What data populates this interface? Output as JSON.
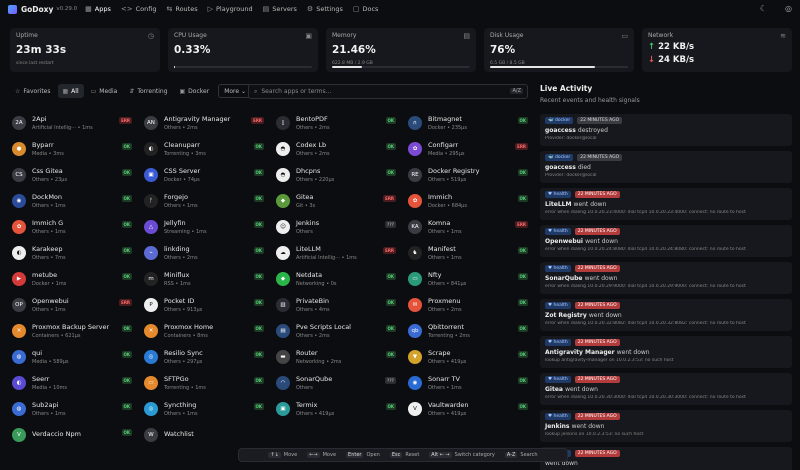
{
  "app": {
    "name": "GoDoxy",
    "version": "v0.29.0"
  },
  "nav": [
    {
      "label": "Apps",
      "icon": "grid-icon",
      "glyph": "▦",
      "active": true
    },
    {
      "label": "Config",
      "icon": "code-icon",
      "glyph": "<>"
    },
    {
      "label": "Routes",
      "icon": "routes-icon",
      "glyph": "⇆"
    },
    {
      "label": "Playground",
      "icon": "playground-icon",
      "glyph": "▷"
    },
    {
      "label": "Servers",
      "icon": "server-icon",
      "glyph": "▤"
    },
    {
      "label": "Settings",
      "icon": "gear-icon",
      "glyph": "⚙"
    },
    {
      "label": "Docs",
      "icon": "book-icon",
      "glyph": "▢"
    }
  ],
  "stats": {
    "uptime": {
      "label": "Uptime",
      "value": "23m 33s",
      "sub": "since last restart"
    },
    "cpu": {
      "label": "CPU Usage",
      "value": "0.33%",
      "fraction": 0.0033
    },
    "memory": {
      "label": "Memory",
      "value": "21.46%",
      "sub": "622.8 MB / 2.9 GB",
      "fraction": 0.2146
    },
    "disk": {
      "label": "Disk Usage",
      "value": "76%",
      "sub": "6.5 GB / 8.5 GB",
      "fraction": 0.76
    },
    "network": {
      "label": "Network",
      "up": "22 KB/s",
      "down": "24 KB/s"
    }
  },
  "filters": {
    "items": [
      {
        "label": "Favorites",
        "glyph": "☆",
        "icon": "star-icon"
      },
      {
        "label": "All",
        "glyph": "▦",
        "icon": "grid-icon",
        "active": true
      },
      {
        "label": "Media",
        "glyph": "▭",
        "icon": "media-icon"
      },
      {
        "label": "Torrenting",
        "glyph": "⇵",
        "icon": "torrent-icon"
      },
      {
        "label": "Docker",
        "glyph": "▣",
        "icon": "docker-icon"
      }
    ],
    "more": "More",
    "search_placeholder": "Search apps or terms...",
    "search_kbd": "A/Z"
  },
  "apps": [
    {
      "name": "2Api",
      "meta": "Artificial Intellig··· • 1ms",
      "status": "ERR",
      "s": "err",
      "color": "#3a3c44",
      "glyph": "2A"
    },
    {
      "name": "Antigravity Manager",
      "meta": "Others • 2ms",
      "status": "ERR",
      "s": "err",
      "color": "#3a3c44",
      "glyph": "AN"
    },
    {
      "name": "BentoPDF",
      "meta": "Others • 2ms",
      "status": "OK",
      "s": "ok",
      "color": "#2a2c33",
      "glyph": "▯"
    },
    {
      "name": "Bitmagnet",
      "meta": "Docker • 235μs",
      "status": "OK",
      "s": "ok",
      "color": "#2a4a7a",
      "glyph": "∩"
    },
    {
      "name": "Byparr",
      "meta": "Media • 3ms",
      "status": "OK",
      "s": "ok",
      "color": "#d88a2c",
      "glyph": "●"
    },
    {
      "name": "Cleanuparr",
      "meta": "Torrenting • 3ms",
      "status": "OK",
      "s": "ok",
      "color": "#222",
      "glyph": "◐"
    },
    {
      "name": "Codex Lb",
      "meta": "Others • 2ms",
      "status": "OK",
      "s": "ok",
      "color": "#eee",
      "glyph": "◓"
    },
    {
      "name": "Configarr",
      "meta": "Media • 295μs",
      "status": "ERR",
      "s": "err",
      "color": "#7b4bd3",
      "glyph": "✿"
    },
    {
      "name": "Css Gitea",
      "meta": "Others • 23μs",
      "status": "OK",
      "s": "ok",
      "color": "#3a3c44",
      "glyph": "CS"
    },
    {
      "name": "CSS Server",
      "meta": "Docker • 74μs",
      "status": "OK",
      "s": "ok",
      "color": "#3a5bd3",
      "glyph": "▣"
    },
    {
      "name": "Dhcpns",
      "meta": "Others • 220μs",
      "status": "OK",
      "s": "ok",
      "color": "#eee",
      "glyph": "◓"
    },
    {
      "name": "Docker Registry",
      "meta": "Others • 519μs",
      "status": "OK",
      "s": "ok",
      "color": "#3a3c44",
      "glyph": "RE"
    },
    {
      "name": "DockMon",
      "meta": "Others • 1ms",
      "status": "OK",
      "s": "ok",
      "color": "#2a4a9a",
      "glyph": "◉"
    },
    {
      "name": "Forgejo",
      "meta": "Others • 1ms",
      "status": "OK",
      "s": "ok",
      "color": "#222",
      "glyph": "ᚠ"
    },
    {
      "name": "Gitea",
      "meta": "Git • 3s",
      "status": "ERR",
      "s": "err",
      "color": "#5a9a3a",
      "glyph": "◆"
    },
    {
      "name": "Immich",
      "meta": "Docker • 684μs",
      "status": "OK",
      "s": "ok",
      "color": "#e5533a",
      "glyph": "✿"
    },
    {
      "name": "Immich G",
      "meta": "Others • 1ms",
      "status": "OK",
      "s": "ok",
      "color": "#e5533a",
      "glyph": "✿"
    },
    {
      "name": "Jellyfin",
      "meta": "Streaming • 1ms",
      "status": "OK",
      "s": "ok",
      "color": "#6a4bd3",
      "glyph": "△"
    },
    {
      "name": "Jenkins",
      "meta": "Others",
      "status": "???",
      "s": "unk",
      "color": "#eee",
      "glyph": "☺"
    },
    {
      "name": "Komna",
      "meta": "Others • 1ms",
      "status": "ERR",
      "s": "err",
      "color": "#3a3c44",
      "glyph": "KA"
    },
    {
      "name": "Karakeep",
      "meta": "Others • 7ms",
      "status": "OK",
      "s": "ok",
      "color": "#eee",
      "glyph": "◐"
    },
    {
      "name": "linkding",
      "meta": "Others • 2ms",
      "status": "OK",
      "s": "ok",
      "color": "#5b6bd3",
      "glyph": "⌁"
    },
    {
      "name": "LiteLLM",
      "meta": "Artificial Intellig··· • 1ms",
      "status": "ERR",
      "s": "err",
      "color": "#eee",
      "glyph": "☁"
    },
    {
      "name": "Manifest",
      "meta": "Others • 1ms",
      "status": "OK",
      "s": "ok",
      "color": "#222",
      "glyph": "♞"
    },
    {
      "name": "metube",
      "meta": "Docker • 1ms",
      "status": "OK",
      "s": "ok",
      "color": "#d33a3a",
      "glyph": "▶"
    },
    {
      "name": "Miniflux",
      "meta": "RSS • 1ms",
      "status": "OK",
      "s": "ok",
      "color": "#222",
      "glyph": "m"
    },
    {
      "name": "Netdata",
      "meta": "Networking • 0s",
      "status": "OK",
      "s": "ok",
      "color": "#2ab54a",
      "glyph": "◆"
    },
    {
      "name": "Nfty",
      "meta": "Others • 841μs",
      "status": "OK",
      "s": "ok",
      "color": "#2a9a7a",
      "glyph": "▭"
    },
    {
      "name": "Openwebui",
      "meta": "Others • 1ms",
      "status": "ERR",
      "s": "err",
      "color": "#3a3c44",
      "glyph": "OP"
    },
    {
      "name": "Pocket ID",
      "meta": "Others • 913μs",
      "status": "OK",
      "s": "ok",
      "color": "#eee",
      "glyph": "P"
    },
    {
      "name": "PrivateBin",
      "meta": "Others • 4ms",
      "status": "OK",
      "s": "ok",
      "color": "#2a2c33",
      "glyph": "▥"
    },
    {
      "name": "Proxmenu",
      "meta": "Others • 2ms",
      "status": "OK",
      "s": "ok",
      "color": "#e5533a",
      "glyph": "✉"
    },
    {
      "name": "Proxmox Backup Server",
      "meta": "Containers • 621μs",
      "status": "OK",
      "s": "ok",
      "color": "#e58a2c",
      "glyph": "✕"
    },
    {
      "name": "Proxmox Home",
      "meta": "Containers • 8ms",
      "status": "OK",
      "s": "ok",
      "color": "#e58a2c",
      "glyph": "✕"
    },
    {
      "name": "Pve Scripts Local",
      "meta": "Others • 2ms",
      "status": "OK",
      "s": "ok",
      "color": "#2a4a7a",
      "glyph": "▤"
    },
    {
      "name": "Qbittorrent",
      "meta": "Torrenting • 2ms",
      "status": "OK",
      "s": "ok",
      "color": "#3a6bd3",
      "glyph": "qb"
    },
    {
      "name": "qui",
      "meta": "Media • 589μs",
      "status": "OK",
      "s": "ok",
      "color": "#3a6bd3",
      "glyph": "◍"
    },
    {
      "name": "Resilio Sync",
      "meta": "Others • 297μs",
      "status": "OK",
      "s": "ok",
      "color": "#2a7ad3",
      "glyph": "◎"
    },
    {
      "name": "Router",
      "meta": "Networking • 2ms",
      "status": "OK",
      "s": "ok",
      "color": "#444",
      "glyph": "▬"
    },
    {
      "name": "Scrape",
      "meta": "Others • 419μs",
      "status": "OK",
      "s": "ok",
      "color": "#d3a32c",
      "glyph": "▼"
    },
    {
      "name": "Seerr",
      "meta": "Media • 10ms",
      "status": "OK",
      "s": "ok",
      "color": "#5b4bd3",
      "glyph": "◐"
    },
    {
      "name": "SFTPGo",
      "meta": "Torrenting • 1ms",
      "status": "OK",
      "s": "ok",
      "color": "#e58a2c",
      "glyph": "▭"
    },
    {
      "name": "SonarQube",
      "meta": "Others",
      "status": "???",
      "s": "unk",
      "color": "#2a4a7a",
      "glyph": "◠"
    },
    {
      "name": "Sonarr TV",
      "meta": "Others • 1ms",
      "status": "OK",
      "s": "ok",
      "color": "#2a6ad3",
      "glyph": "◉"
    },
    {
      "name": "Sub2api",
      "meta": "Others • 1ms",
      "status": "OK",
      "s": "ok",
      "color": "#3a6bd3",
      "glyph": "◍"
    },
    {
      "name": "Syncthing",
      "meta": "Others • 1ms",
      "status": "OK",
      "s": "ok",
      "color": "#2a9ad3",
      "glyph": "◎"
    },
    {
      "name": "Termix",
      "meta": "Others • 419μs",
      "status": "OK",
      "s": "ok",
      "color": "#2a9a9a",
      "glyph": "▣"
    },
    {
      "name": "Vaultwarden",
      "meta": "Others • 419μs",
      "status": "OK",
      "s": "ok",
      "color": "#eee",
      "glyph": "V"
    },
    {
      "name": "Verdaccio Npm",
      "meta": "",
      "status": "OK",
      "s": "ok",
      "color": "#3a9a5a",
      "glyph": "V"
    },
    {
      "name": "Watchlist",
      "meta": "",
      "status": "",
      "s": "",
      "color": "#3a3c44",
      "glyph": "W"
    }
  ],
  "activity": {
    "title": "Live Activity",
    "subtitle": "Recent events and health signals",
    "events": [
      {
        "tag": "docker",
        "time": "22 MINUTES AGO",
        "red": false,
        "name": "goaccess",
        "action": "destroyed",
        "detail": "Provider: docker@local"
      },
      {
        "tag": "docker",
        "time": "22 MINUTES AGO",
        "red": false,
        "name": "goaccess",
        "action": "died",
        "detail": "Provider: docker@local"
      },
      {
        "tag": "health",
        "time": "22 MINUTES AGO",
        "red": true,
        "name": "LiteLLM",
        "action": "went down",
        "detail": "error when dialing 10.0.20.23:4000: dial tcp4 10.0.20.23:4000: connect: no route to host"
      },
      {
        "tag": "health",
        "time": "22 MINUTES AGO",
        "red": true,
        "name": "Openwebui",
        "action": "went down",
        "detail": "error when dialing 10.0.20.24:8080: dial tcp4 10.0.20.24:8080: connect: no route to host"
      },
      {
        "tag": "health",
        "time": "22 MINUTES AGO",
        "red": true,
        "name": "SonarQube",
        "action": "went down",
        "detail": "error when dialing 10.0.20.29:9000: dial tcp4 10.0.20.29:9000: connect: no route to host"
      },
      {
        "tag": "health",
        "time": "22 MINUTES AGO",
        "red": true,
        "name": "Zot Registry",
        "action": "went down",
        "detail": "error when dialing 10.0.20.32:8082: dial tcp4 10.0.20.32:8082: connect: no route to host"
      },
      {
        "tag": "health",
        "time": "22 MINUTES AGO",
        "red": true,
        "name": "Antigravity Manager",
        "action": "went down",
        "detail": "lookup antigravity-manager on 10.0.2.3:53: no such host"
      },
      {
        "tag": "health",
        "time": "22 MINUTES AGO",
        "red": true,
        "name": "Gitea",
        "action": "went down",
        "detail": "error when dialing 10.0.20.30:3000: dial tcp4 10.0.20.30:3000: connect: no route to host"
      },
      {
        "tag": "health",
        "time": "22 MINUTES AGO",
        "red": true,
        "name": "Jenkins",
        "action": "went down",
        "detail": "lookup jenkins on 10.0.2.3:53: no such host"
      },
      {
        "tag": "health",
        "time": "22 MINUTES AGO",
        "red": true,
        "name": "",
        "action": "went down",
        "detail": ""
      }
    ]
  },
  "shortcuts": [
    {
      "key": "↑↓",
      "label": "Move"
    },
    {
      "key": "←→",
      "label": "Move"
    },
    {
      "key": "Enter",
      "label": "Open"
    },
    {
      "key": "Esc",
      "label": "Reset"
    },
    {
      "key": "Alt ← →",
      "label": "Switch category"
    },
    {
      "key": "A-Z",
      "label": "Search"
    }
  ]
}
